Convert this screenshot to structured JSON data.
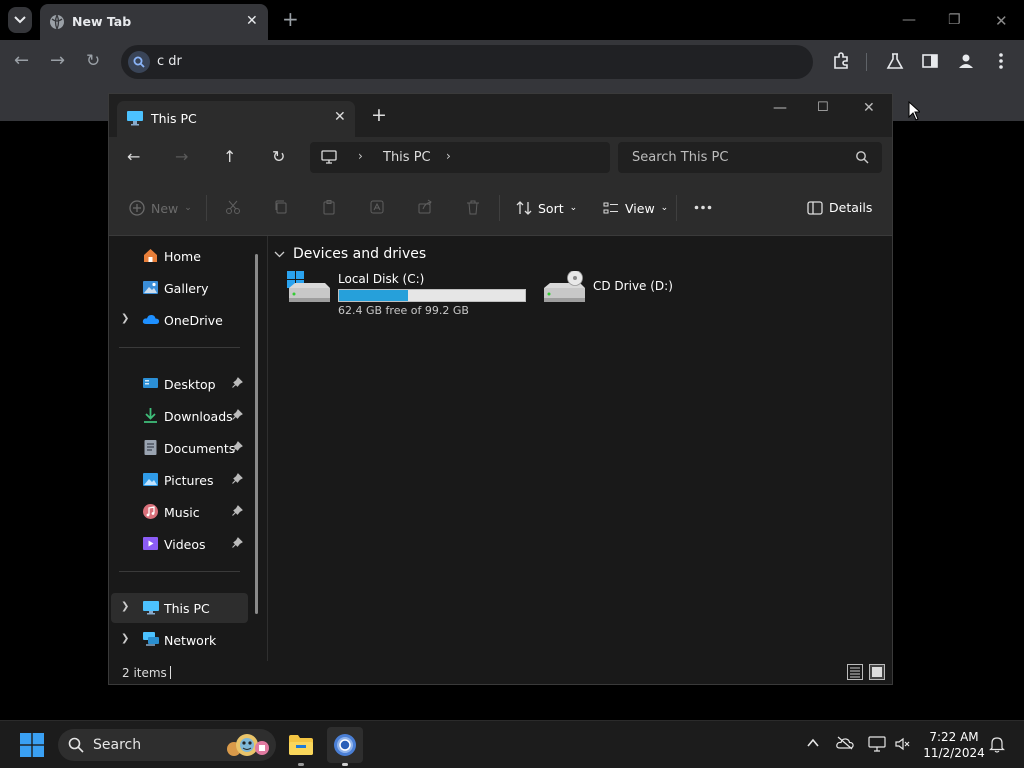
{
  "browser": {
    "tab_title": "New Tab",
    "omnibox_text": "c dr"
  },
  "explorer": {
    "tab_title": "This PC",
    "breadcrumb": "This PC",
    "search_placeholder": "Search This PC",
    "commands": {
      "new": "New",
      "sort": "Sort",
      "view": "View",
      "details": "Details"
    },
    "sidebar": {
      "items": [
        {
          "label": "Home"
        },
        {
          "label": "Gallery"
        },
        {
          "label": "OneDrive"
        },
        {
          "label": "Desktop"
        },
        {
          "label": "Downloads"
        },
        {
          "label": "Documents"
        },
        {
          "label": "Pictures"
        },
        {
          "label": "Music"
        },
        {
          "label": "Videos"
        },
        {
          "label": "This PC"
        },
        {
          "label": "Network"
        }
      ]
    },
    "group_title": "Devices and drives",
    "drives": [
      {
        "name": "Local Disk (C:)",
        "free_text": "62.4 GB free of 99.2 GB",
        "used_fraction": 0.37
      },
      {
        "name": "CD Drive (D:)"
      }
    ],
    "status_count": "2 items"
  },
  "taskbar": {
    "search_label": "Search",
    "time": "7:22 AM",
    "date": "11/2/2024"
  },
  "colors": {
    "accent": "#26a0da",
    "selection": "#2d2d2d"
  }
}
